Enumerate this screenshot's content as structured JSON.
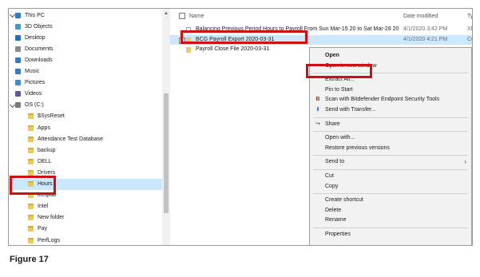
{
  "nav_pane": {
    "items": [
      {
        "label": "This PC",
        "icon": "monitor-icon",
        "expanded": true
      },
      {
        "label": "3D Objects",
        "icon": "cube-icon"
      },
      {
        "label": "Desktop",
        "icon": "desktop-icon"
      },
      {
        "label": "Documents",
        "icon": "documents-icon"
      },
      {
        "label": "Downloads",
        "icon": "download-arrow-icon"
      },
      {
        "label": "Music",
        "icon": "music-note-icon"
      },
      {
        "label": "Pictures",
        "icon": "pictures-icon"
      },
      {
        "label": "Videos",
        "icon": "videos-icon"
      },
      {
        "label": "OS (C:)",
        "icon": "drive-icon",
        "expanded": true
      },
      {
        "label": "$SysReset",
        "icon": "folder-icon"
      },
      {
        "label": "Apps",
        "icon": "folder-icon"
      },
      {
        "label": "Attendance Test Database",
        "icon": "folder-icon"
      },
      {
        "label": "backup",
        "icon": "folder-icon"
      },
      {
        "label": "DELL",
        "icon": "folder-icon"
      },
      {
        "label": "Drivers",
        "icon": "folder-icon"
      },
      {
        "label": "Hours",
        "icon": "folder-icon",
        "selected": true
      },
      {
        "label": "inetpub",
        "icon": "folder-icon"
      },
      {
        "label": "Intel",
        "icon": "folder-icon"
      },
      {
        "label": "New folder",
        "icon": "folder-icon"
      },
      {
        "label": "Pay",
        "icon": "folder-icon"
      },
      {
        "label": "PerfLogs",
        "icon": "folder-icon"
      }
    ]
  },
  "file_pane": {
    "columns": {
      "name": "Name",
      "date_modified": "Date modified",
      "type": "Typ"
    },
    "files": [
      {
        "name": "Balancing Previous Period Hours to Payroll From Sun Mar-15 20 to Sat Mar-28 20",
        "date": "4/1/2020 3:42 PM",
        "type": "XM",
        "icon": "document-icon"
      },
      {
        "name": "BCG Payroll Export 2020-03-31",
        "date": "4/1/2020 4:21 PM",
        "type": "Co",
        "icon": "zip-folder-icon",
        "selected": true
      },
      {
        "name": "Payroll Close File 2020-03-31",
        "date": "",
        "type": "",
        "icon": "zip-folder-icon"
      }
    ]
  },
  "context_menu": {
    "groups": [
      [
        {
          "label": "Open",
          "bold": true
        },
        {
          "label": "Open in new window"
        }
      ],
      [
        {
          "label": "Extract All..."
        },
        {
          "label": "Pin to Start"
        },
        {
          "label": "Scan with Bitdefender Endpoint Security Tools",
          "icon": "bitdefender-icon"
        },
        {
          "label": "Send with Transfer...",
          "icon": "transfer-icon"
        }
      ],
      [
        {
          "label": "Share",
          "icon": "share-icon"
        }
      ],
      [
        {
          "label": "Open with..."
        },
        {
          "label": "Restore previous versions"
        }
      ],
      [
        {
          "label": "Send to",
          "submenu": true
        }
      ],
      [
        {
          "label": "Cut"
        },
        {
          "label": "Copy"
        }
      ],
      [
        {
          "label": "Create shortcut"
        },
        {
          "label": "Delete"
        },
        {
          "label": "Rename"
        }
      ],
      [
        {
          "label": "Properties"
        }
      ]
    ]
  },
  "caption": "Figure 17",
  "colors": {
    "highlight_red": "#d20f0f",
    "selection_blue": "#cce8ff",
    "folder_yellow": "#f2c94c",
    "menu_bg": "#f2f2f2"
  }
}
